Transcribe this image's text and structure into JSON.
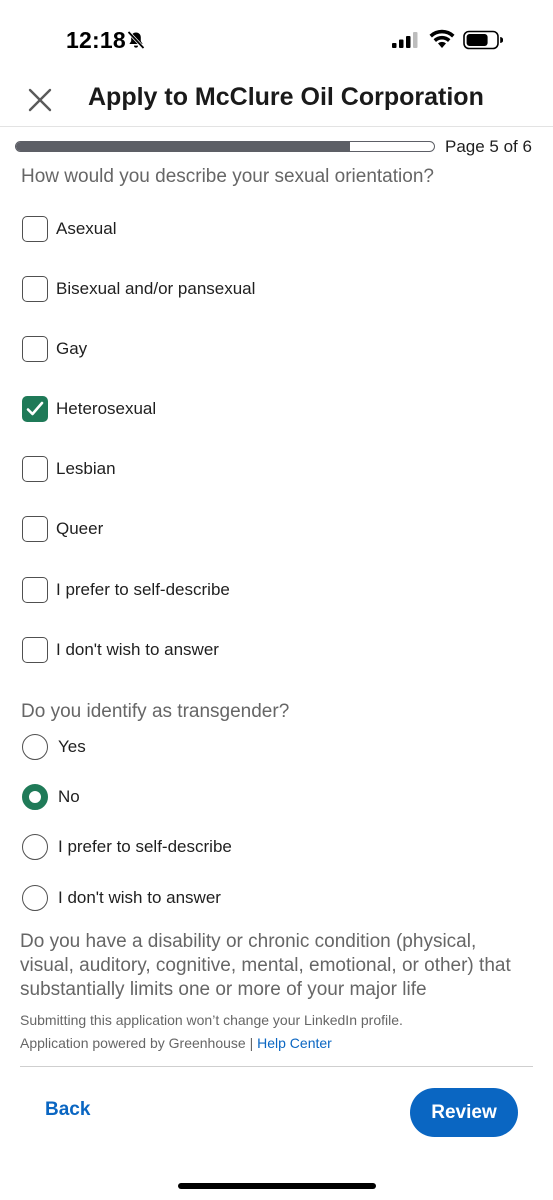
{
  "status_bar": {
    "time": "12:18"
  },
  "header": {
    "title": "Apply to McClure Oil Corporation"
  },
  "progress": {
    "label": "Page 5 of 6",
    "fraction": 0.8
  },
  "sexual_orientation": {
    "question": "How would you describe your sexual orientation?",
    "options": [
      {
        "label": "Asexual",
        "checked": false
      },
      {
        "label": "Bisexual and/or pansexual",
        "checked": false
      },
      {
        "label": "Gay",
        "checked": false
      },
      {
        "label": "Heterosexual",
        "checked": true
      },
      {
        "label": "Lesbian",
        "checked": false
      },
      {
        "label": "Queer",
        "checked": false
      },
      {
        "label": "I prefer to self-describe",
        "checked": false
      },
      {
        "label": "I don't wish to answer",
        "checked": false
      }
    ]
  },
  "transgender": {
    "question": "Do you identify as transgender?",
    "options": [
      {
        "label": "Yes",
        "selected": false
      },
      {
        "label": "No",
        "selected": true
      },
      {
        "label": "I prefer to self-describe",
        "selected": false
      },
      {
        "label": "I don't wish to answer",
        "selected": false
      }
    ]
  },
  "disability": {
    "question": "Do you have a disability or chronic condition (physical, visual, auditory, cognitive, mental, emotional, or other) that substantially limits one or more of your major life"
  },
  "footer": {
    "profile_note": "Submitting this application won’t change your LinkedIn profile.",
    "powered_by": "Application powered by Greenhouse |",
    "help_center": "Help Center",
    "back_label": "Back",
    "review_label": "Review"
  },
  "colors": {
    "accent_blue": "#0a66c2",
    "checked_green": "#1f7a58",
    "progress_gray": "#5d5f66"
  }
}
